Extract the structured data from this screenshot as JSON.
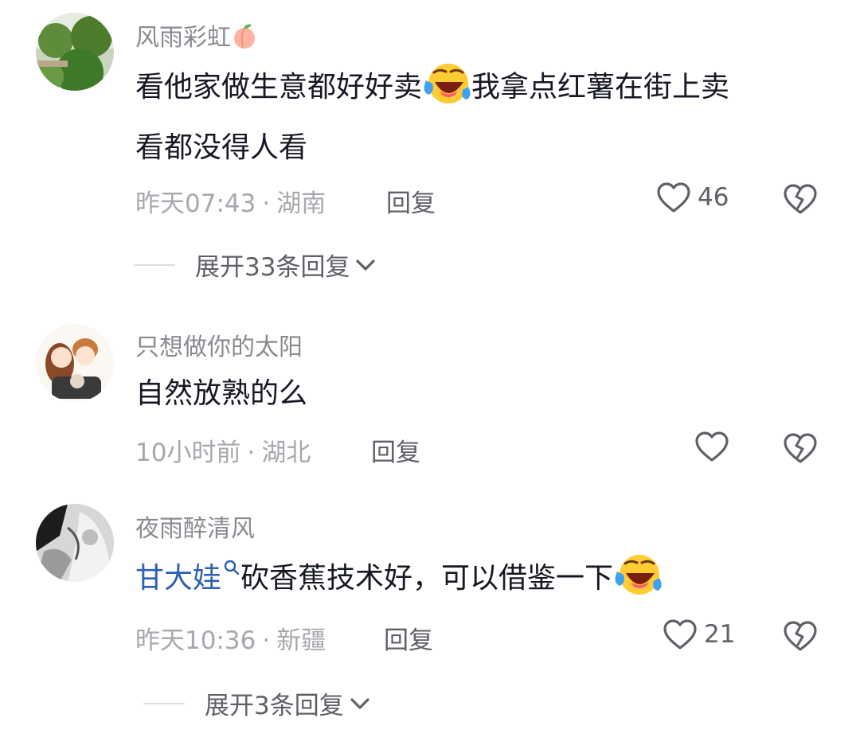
{
  "comments": [
    {
      "username": "风雨彩虹",
      "username_emoji": "peach-emoji",
      "text_part1": "看他家做生意都好好卖",
      "text_emoji": "crying-laughing-emoji",
      "text_part2": "我拿点红薯在街上卖",
      "text_line2": "看都没得人看",
      "time": "昨天07:43",
      "location": "湖南",
      "reply_label": "回复",
      "likes": "46",
      "expand_label": "展开33条回复"
    },
    {
      "username": "只想做你的太阳",
      "text": "自然放熟的么",
      "time": "10小时前",
      "location": "湖北",
      "reply_label": "回复",
      "likes": ""
    },
    {
      "username": "夜雨醉清风",
      "mention": "甘大娃",
      "text": "砍香蕉技术好，可以借鉴一下",
      "text_emoji": "crying-laughing-emoji",
      "time": "昨天10:36",
      "location": "新疆",
      "reply_label": "回复",
      "likes": "21",
      "expand_label": "展开3条回复"
    }
  ],
  "separator": "·",
  "colors": {
    "username": "#8a8b91",
    "text": "#161823",
    "meta": "#a7a8ae",
    "mention": "#2d5fb5",
    "icon": "#5f6068"
  }
}
